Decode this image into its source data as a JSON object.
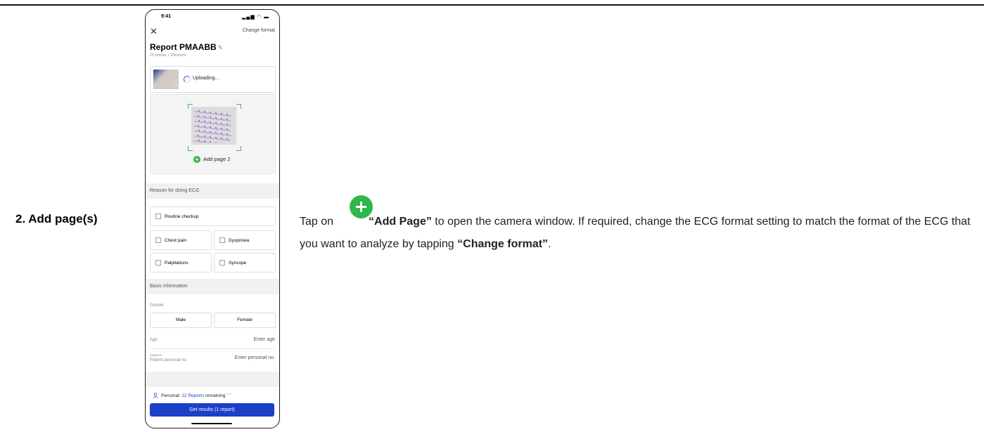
{
  "step": {
    "label": "2. Add page(s)"
  },
  "phone": {
    "status_time": "9:41",
    "status_icons": "signal-wifi-battery",
    "change_format": "Change format",
    "report_title": "Report PMAABB",
    "report_sub": "25 mm/sec • 10mm/mV",
    "uploading": "Uploading...",
    "add_page": "Add page 2",
    "reason_heading": "Reason for doing ECG",
    "reasons": {
      "routine": "Routine checkup",
      "chest_pain": "Chest pain",
      "dyspnoea": "Dyspnoea",
      "palpitations": "Palpitations",
      "syncope": "Syncope"
    },
    "basic_heading": "Basic information",
    "gender_label": "Gender",
    "gender_male": "Male",
    "gender_female": "Female",
    "age_label": "Age",
    "age_placeholder": "Enter age",
    "optional_label": "Optional",
    "personal_no_label": "Patient personal no.",
    "personal_no_placeholder": "Enter personal no.",
    "personal_prefix": "Personal:",
    "personal_reports": "12 Reports",
    "personal_suffix": "remaining",
    "cta": "Get results (1 report)"
  },
  "instruction": {
    "pre": "Tap on",
    "add_page": "“Add Page”",
    "mid": " to open the camera window. If required, change the ECG format setting to match the format of the ECG that you want to analyze by tapping ",
    "change_format": "“Change format”",
    "end": "."
  },
  "colors": {
    "green": "#2eb84b",
    "blue": "#1b3fc9",
    "ecg_trace": "#7a2bd1"
  }
}
